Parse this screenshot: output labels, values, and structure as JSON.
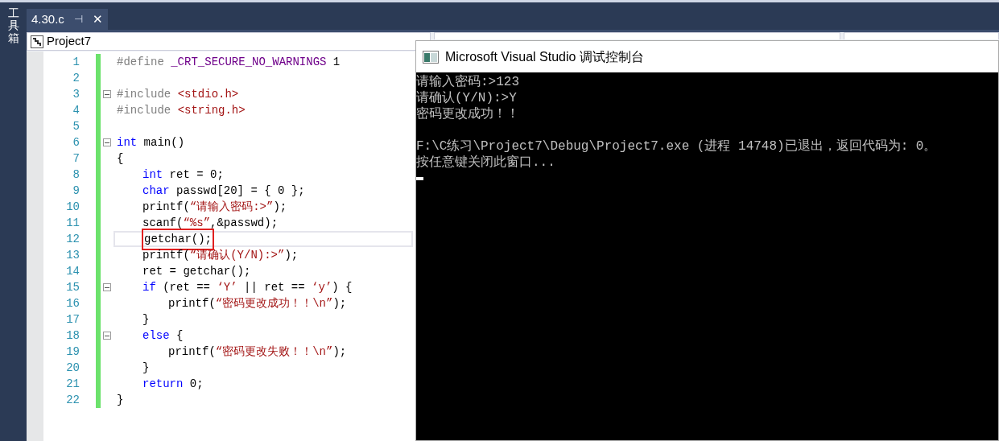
{
  "sidebar": {
    "label": "工具箱"
  },
  "tabs": [
    {
      "label": "4.30.c",
      "selected": true,
      "pin": "⊣",
      "close": "✕"
    }
  ],
  "nav": {
    "project": "Project7"
  },
  "editor": {
    "lines": [
      {
        "number": "1",
        "fold": false,
        "current": false,
        "tokens": [
          {
            "kind": "preproc",
            "text": "#define "
          },
          {
            "kind": "macro",
            "text": "_CRT_SECURE_NO_WARNINGS"
          },
          {
            "kind": "plain",
            "text": " 1"
          }
        ]
      },
      {
        "number": "2",
        "fold": false,
        "current": false
      },
      {
        "number": "3",
        "fold": true,
        "current": false,
        "tokens": [
          {
            "kind": "preproc",
            "text": "#include "
          },
          {
            "kind": "string",
            "text": "<stdio.h>"
          }
        ]
      },
      {
        "number": "4",
        "fold": false,
        "current": false,
        "tokens": [
          {
            "kind": "preproc",
            "text": "#include "
          },
          {
            "kind": "string",
            "text": "<string.h>"
          }
        ]
      },
      {
        "number": "5",
        "fold": false,
        "current": false
      },
      {
        "number": "6",
        "fold": true,
        "current": false,
        "tokens": [
          {
            "kind": "keyword",
            "text": "int"
          },
          {
            "kind": "plain",
            "text": " main()"
          }
        ]
      },
      {
        "number": "7",
        "fold": false,
        "current": false,
        "tokens": [
          {
            "kind": "plain",
            "text": "{"
          }
        ],
        "children": [
          {
            "number": "8",
            "fold": false,
            "current": false,
            "tokens": [
              {
                "kind": "keyword",
                "text": "int"
              },
              {
                "kind": "plain",
                "text": " ret = 0;"
              }
            ]
          },
          {
            "number": "9",
            "fold": false,
            "current": false,
            "tokens": [
              {
                "kind": "keyword",
                "text": "char"
              },
              {
                "kind": "plain",
                "text": " passwd[20] = { 0 };"
              }
            ]
          },
          {
            "number": "10",
            "fold": false,
            "current": false,
            "tokens": [
              {
                "kind": "plain",
                "text": "printf("
              },
              {
                "kind": "string",
                "text": "“请输入密码:>”"
              },
              {
                "kind": "plain",
                "text": ");"
              }
            ]
          },
          {
            "number": "11",
            "fold": false,
            "current": false,
            "tokens": [
              {
                "kind": "plain",
                "text": "scanf("
              },
              {
                "kind": "string",
                "text": "“%s”"
              },
              {
                "kind": "plain",
                "text": ",&passwd);"
              }
            ]
          },
          {
            "number": "12",
            "fold": false,
            "current": true,
            "tokens": [
              {
                "kind": "boxed",
                "text": "getchar();"
              }
            ]
          },
          {
            "number": "13",
            "fold": false,
            "current": false,
            "tokens": [
              {
                "kind": "plain",
                "text": "printf("
              },
              {
                "kind": "string",
                "text": "“请确认(Y/N):>”"
              },
              {
                "kind": "plain",
                "text": ");"
              }
            ]
          },
          {
            "number": "14",
            "fold": false,
            "current": false,
            "tokens": [
              {
                "kind": "plain",
                "text": "ret = getchar();"
              }
            ]
          },
          {
            "number": "15",
            "fold": true,
            "current": false,
            "tokens": [
              {
                "kind": "keyword",
                "text": "if"
              },
              {
                "kind": "plain",
                "text": " (ret == "
              },
              {
                "kind": "string",
                "text": "‘Y’"
              },
              {
                "kind": "plain",
                "text": " || ret == "
              },
              {
                "kind": "string",
                "text": "‘y’"
              },
              {
                "kind": "plain",
                "text": ") {"
              }
            ],
            "children": [
              {
                "number": "16",
                "fold": false,
                "current": false,
                "tokens": [
                  {
                    "kind": "plain",
                    "text": "printf("
                  },
                  {
                    "kind": "string",
                    "text": "“密码更改成功！！\\n”"
                  },
                  {
                    "kind": "plain",
                    "text": ");"
                  }
                ]
              }
            ]
          },
          {
            "number": "17",
            "fold": false,
            "current": false,
            "tokens": [
              {
                "kind": "plain",
                "text": "}"
              }
            ]
          },
          {
            "number": "18",
            "fold": true,
            "current": false,
            "tokens": [
              {
                "kind": "keyword",
                "text": "else"
              },
              {
                "kind": "plain",
                "text": " {"
              }
            ],
            "children": [
              {
                "number": "19",
                "fold": false,
                "current": false,
                "tokens": [
                  {
                    "kind": "plain",
                    "text": "printf("
                  },
                  {
                    "kind": "string",
                    "text": "“密码更改失败！！\\n”"
                  },
                  {
                    "kind": "plain",
                    "text": ");"
                  }
                ]
              }
            ]
          },
          {
            "number": "20",
            "fold": false,
            "current": false,
            "tokens": [
              {
                "kind": "plain",
                "text": "}"
              }
            ]
          },
          {
            "number": "21",
            "fold": false,
            "current": false,
            "tokens": [
              {
                "kind": "keyword",
                "text": "return"
              },
              {
                "kind": "plain",
                "text": " 0;"
              }
            ]
          }
        ]
      },
      {
        "number": "22",
        "fold": false,
        "current": false,
        "tokens": [
          {
            "kind": "plain",
            "text": "}"
          }
        ]
      }
    ]
  },
  "console": {
    "title": "Microsoft Visual Studio 调试控制台",
    "paragraphs": [
      [
        "请输入密码:>123",
        "请确认(Y/N):>Y",
        "密码更改成功！！"
      ],
      [
        "F:\\C练习\\Project7\\Debug\\Project7.exe (进程 14748)已退出，返回代码为: 0。",
        "按任意键关闭此窗口..."
      ]
    ],
    "cursor": true
  }
}
